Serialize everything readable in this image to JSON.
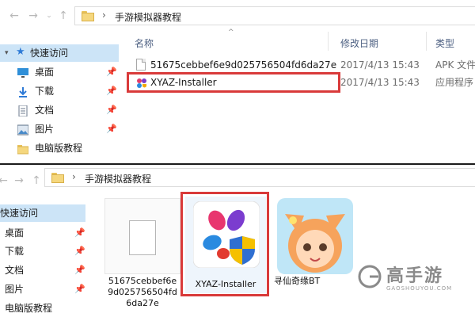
{
  "colors": {
    "accent_red": "#d93a3a",
    "selection": "#cce4f7",
    "folder": "#f5d77e"
  },
  "top": {
    "breadcrumb": "手游模拟器教程",
    "sidebar": [
      {
        "label": "快速访问",
        "icon": "star-icon",
        "selected": true
      },
      {
        "label": "桌面",
        "icon": "desktop-icon",
        "pinned": true
      },
      {
        "label": "下载",
        "icon": "download-icon",
        "pinned": true
      },
      {
        "label": "文档",
        "icon": "document-icon",
        "pinned": true
      },
      {
        "label": "图片",
        "icon": "picture-icon",
        "pinned": true
      },
      {
        "label": "电脑版教程",
        "icon": "folder-icon"
      }
    ],
    "columns": {
      "name": "名称",
      "date": "修改日期",
      "type": "类型"
    },
    "files": [
      {
        "name": "51675cebbef6e9d025756504fd6da27e",
        "date": "2017/4/13 15:43",
        "type": "APK 文件"
      },
      {
        "name": "XYAZ-Installer",
        "date": "2017/4/13 15:43",
        "type": "应用程序"
      }
    ]
  },
  "bottom": {
    "breadcrumb": "手游模拟器教程",
    "sidebar": [
      {
        "label": "快速访问",
        "selected": true
      },
      {
        "label": "桌面"
      },
      {
        "label": "下载"
      },
      {
        "label": "文档"
      },
      {
        "label": "图片"
      },
      {
        "label": "电脑版教程"
      }
    ],
    "tiles": [
      {
        "caption_lines": [
          "51675cebbef6e",
          "9d025756504fd",
          "6da27e"
        ]
      },
      {
        "caption": "XYAZ-Installer"
      },
      {
        "caption": "寻仙奇缘BT"
      }
    ]
  },
  "watermark": {
    "brand": "高手游",
    "domain": "GAOSHOUYOU.COM"
  }
}
